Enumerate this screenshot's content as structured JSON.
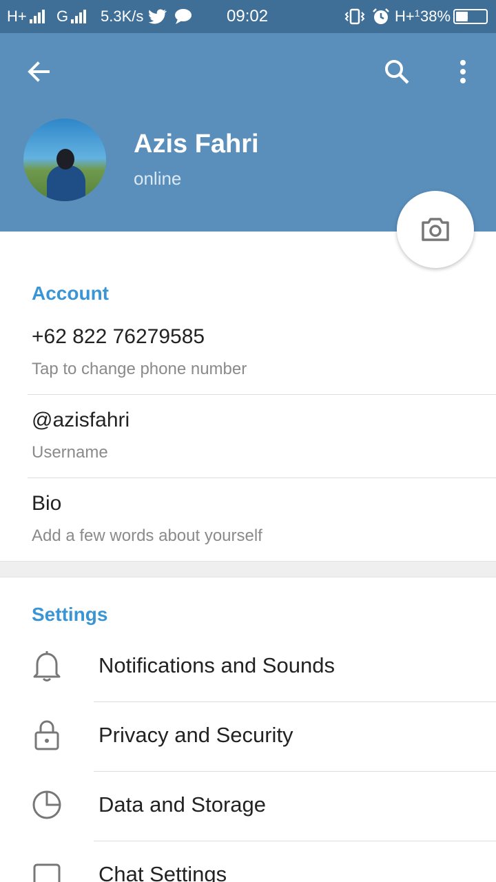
{
  "status_bar": {
    "network1": "H+",
    "network2": "G",
    "speed": "5.3K/s",
    "time": "09:02",
    "network3": "H+",
    "network3_sub": "1",
    "battery": "38%"
  },
  "header": {
    "name": "Azis Fahri",
    "status": "online"
  },
  "account": {
    "title": "Account",
    "phone": "+62 822 76279585",
    "phone_hint": "Tap to change phone number",
    "username": "@azisfahri",
    "username_label": "Username",
    "bio": "Bio",
    "bio_hint": "Add a few words about yourself"
  },
  "settings": {
    "title": "Settings",
    "items": [
      {
        "label": "Notifications and Sounds",
        "icon": "bell-icon"
      },
      {
        "label": "Privacy and Security",
        "icon": "lock-icon"
      },
      {
        "label": "Data and Storage",
        "icon": "pie-chart-icon"
      },
      {
        "label": "Chat Settings",
        "icon": "chat-icon"
      }
    ]
  },
  "colors": {
    "status_bar": "#3f6f97",
    "header": "#5a8fbb",
    "accent": "#3a95d5"
  }
}
